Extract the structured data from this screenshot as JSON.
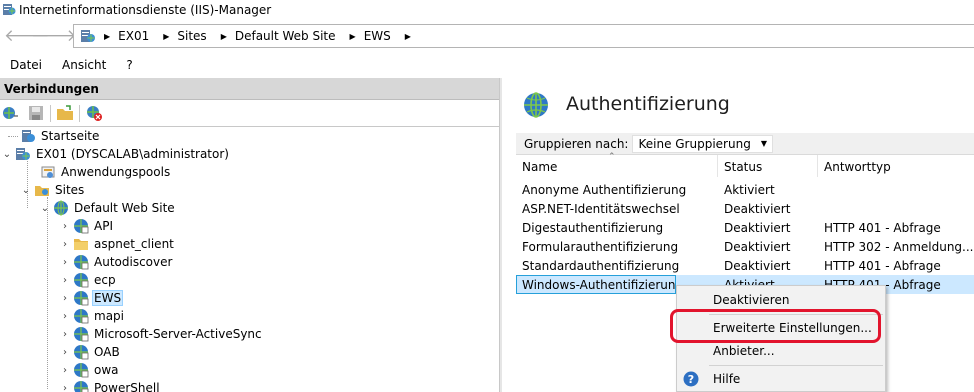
{
  "window": {
    "title": "Internetinformationsdienste (IIS)-Manager"
  },
  "navigation": {
    "back_icon": "arrow-left-icon",
    "forward_icon": "arrow-right-icon",
    "breadcrumbs": [
      "EX01",
      "Sites",
      "Default Web Site",
      "EWS"
    ]
  },
  "menu": [
    "Datei",
    "Ansicht",
    "?"
  ],
  "connections": {
    "header": "Verbindungen",
    "tree": [
      {
        "label": "Startseite",
        "icon": "start-page-icon"
      },
      {
        "label": "EX01 (DYSCALAB\\administrator)",
        "icon": "server-icon"
      },
      {
        "label": "Anwendungspools",
        "icon": "app-pool-icon"
      },
      {
        "label": "Sites",
        "icon": "sites-folder-icon"
      },
      {
        "label": "Default Web Site",
        "icon": "website-globe-icon"
      },
      {
        "label": "API",
        "icon": "web-app-icon"
      },
      {
        "label": "aspnet_client",
        "icon": "folder-icon"
      },
      {
        "label": "Autodiscover",
        "icon": "web-app-icon"
      },
      {
        "label": "ecp",
        "icon": "web-app-icon"
      },
      {
        "label": "EWS",
        "icon": "web-app-icon",
        "selected": true
      },
      {
        "label": "mapi",
        "icon": "web-app-icon"
      },
      {
        "label": "Microsoft-Server-ActiveSync",
        "icon": "web-app-icon"
      },
      {
        "label": "OAB",
        "icon": "web-app-icon"
      },
      {
        "label": "owa",
        "icon": "web-app-icon"
      },
      {
        "label": "PowerShell",
        "icon": "web-app-icon"
      }
    ]
  },
  "feature": {
    "title": "Authentifizierung",
    "group_label": "Gruppieren nach:",
    "group_value": "Keine Gruppierung",
    "columns": [
      "Name",
      "Status",
      "Antworttyp"
    ],
    "rows": [
      [
        "Anonyme Authentifizierung",
        "Aktiviert",
        ""
      ],
      [
        "ASP.NET-Identitätswechsel",
        "Deaktiviert",
        ""
      ],
      [
        "Digestauthentifizierung",
        "Deaktiviert",
        "HTTP 401 - Abfrage"
      ],
      [
        "Formularauthentifizierung",
        "Deaktiviert",
        "HTTP 302 - Anmeldung..."
      ],
      [
        "Standardauthentifizierung",
        "Deaktiviert",
        "HTTP 401 - Abfrage"
      ],
      [
        "Windows-Authentifizierung",
        "Aktiviert",
        "HTTP 401 - Abfrage"
      ]
    ],
    "selected_row": 5
  },
  "context_menu": {
    "items": [
      "Deaktivieren",
      "Erweiterte Einstellungen...",
      "Anbieter...",
      "Hilfe"
    ],
    "highlighted_color": "#e2142d"
  }
}
